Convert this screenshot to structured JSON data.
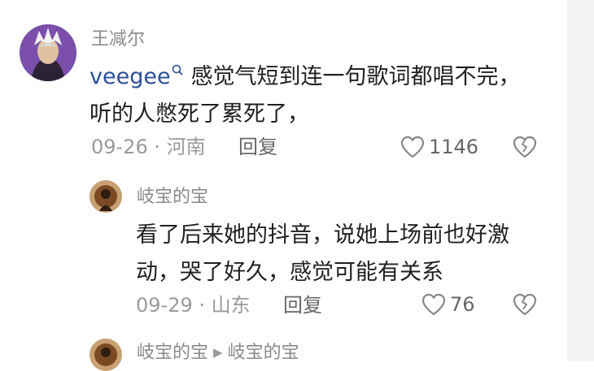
{
  "comments": [
    {
      "username": "王减尔",
      "mention": "veegee",
      "text": "感觉气短到连一句歌词都唱不完，",
      "text_line2": "听的人憋死了累死了，",
      "date": "09-26",
      "location": "河南",
      "reply_label": "回复",
      "likes": "1146"
    },
    {
      "username": "岐宝的宝",
      "text": "看了后来她的抖音，说她上场前也好激",
      "text_line2": "动，哭了好久，感觉可能有关系",
      "date": "09-29",
      "location": "山东",
      "reply_label": "回复",
      "likes": "76"
    },
    {
      "username": "岐宝的宝",
      "reply_to": "岐宝的宝"
    }
  ],
  "separator": "·",
  "icons": {
    "like": "heart-outline-icon",
    "dislike": "heart-broken-icon",
    "mention": "search-icon"
  },
  "colors": {
    "username": "#8a8a8a",
    "mention": "#2a4f9c",
    "body": "#1f1f1f",
    "meta": "#9a9a9a"
  }
}
